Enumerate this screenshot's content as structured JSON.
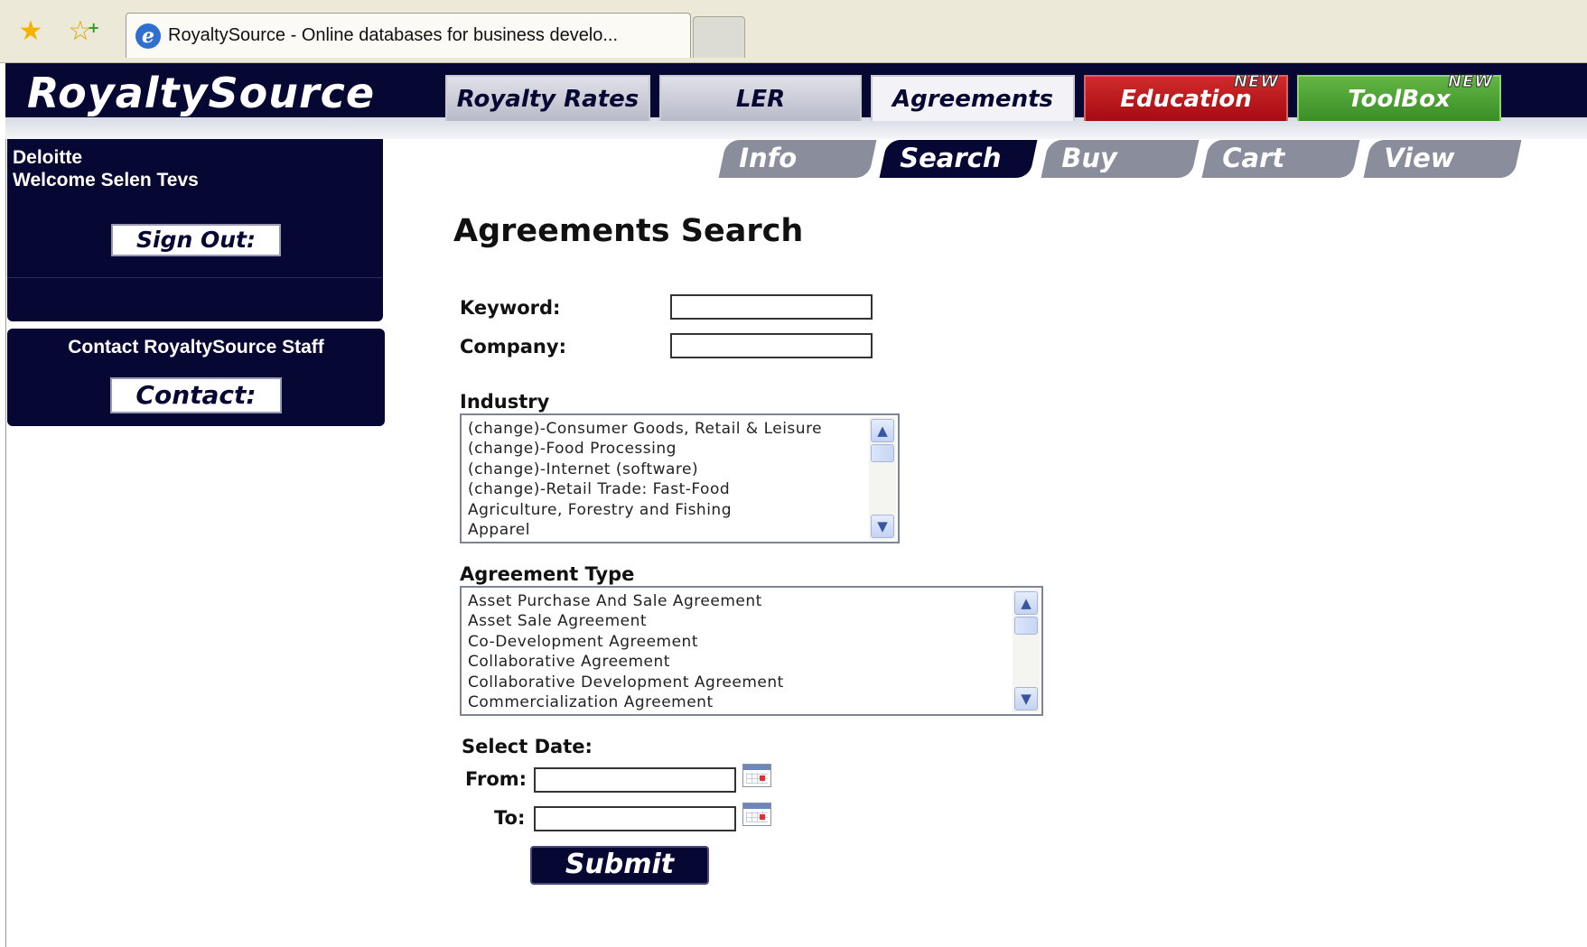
{
  "browser": {
    "tab_title": "RoyaltySource - Online databases for business develo..."
  },
  "site": {
    "logo": "RoyaltySource",
    "nav": {
      "royalty_rates": "Royalty Rates",
      "ler": "LER",
      "agreements": "Agreements",
      "education": "Education",
      "toolbox": "ToolBox",
      "new_badge": "NEW"
    },
    "colors": {
      "navy": "#070733",
      "education": "#b5161d",
      "toolbox": "#4aa031"
    }
  },
  "sidebar": {
    "company": "Deloitte",
    "welcome": "Welcome Selen Tevs",
    "sign_out": "Sign Out:",
    "contact_label": "Contact RoyaltySource Staff",
    "contact_button": "Contact:"
  },
  "subtabs": {
    "info": "Info",
    "search": "Search",
    "buy": "Buy",
    "cart": "Cart",
    "view": "View"
  },
  "form": {
    "title": "Agreements Search",
    "keyword_label": "Keyword:",
    "keyword_value": "",
    "company_label": "Company:",
    "company_value": "",
    "industry_label": "Industry",
    "industry_options": [
      "(change)-Consumer Goods, Retail & Leisure",
      "(change)-Food Processing",
      "(change)-Internet (software)",
      "(change)-Retail Trade: Fast-Food",
      "Agriculture, Forestry and Fishing",
      "Apparel"
    ],
    "agreement_type_label": "Agreement Type",
    "agreement_type_options": [
      "Asset Purchase And Sale Agreement",
      "Asset Sale Agreement",
      "Co-Development Agreement",
      "Collaborative Agreement",
      "Collaborative Development Agreement",
      "Commercialization Agreement"
    ],
    "select_date_label": "Select Date:",
    "from_label": "From:",
    "from_value": "",
    "to_label": "To:",
    "to_value": "",
    "submit": "Submit"
  }
}
